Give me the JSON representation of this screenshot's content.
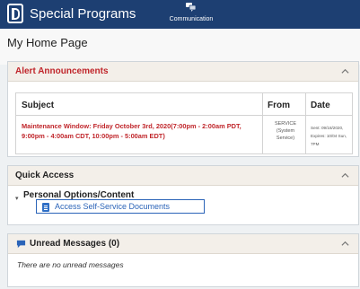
{
  "header": {
    "app_title": "Special Programs",
    "communication_label": "Communication",
    "bar_color": "#1d3f72"
  },
  "page": {
    "title": "My Home Page"
  },
  "alerts": {
    "title": "Alert Announcements",
    "columns": [
      "Subject",
      "From",
      "Date"
    ],
    "rows": [
      {
        "subject": "Maintenance Window: Friday October 3rd, 2020(7:00pm - 2:00am PDT, 9:00pm - 4:00am CDT, 10:00pm - 5:00am EDT)",
        "from_lines": [
          "SERVICE",
          "(System",
          "Service)"
        ],
        "sent": "Sent: 09/18/2020,",
        "expires": "Expires: 10/04 Sun, 7PM"
      }
    ],
    "accent_color": "#c0262b"
  },
  "quick_access": {
    "title": "Quick Access",
    "group_label": "Personal Options/Content",
    "link_label": "Access Self-Service Documents",
    "link_color": "#2b64b8"
  },
  "messages": {
    "title": "Unread Messages (0)",
    "empty_text": "There are no unread messages"
  },
  "icons": {
    "logo": "p-logo-icon",
    "communication": "chat-bubbles-icon",
    "document": "document-icon",
    "messages": "message-bubble-icon",
    "collapse": "chevron-up-icon"
  }
}
